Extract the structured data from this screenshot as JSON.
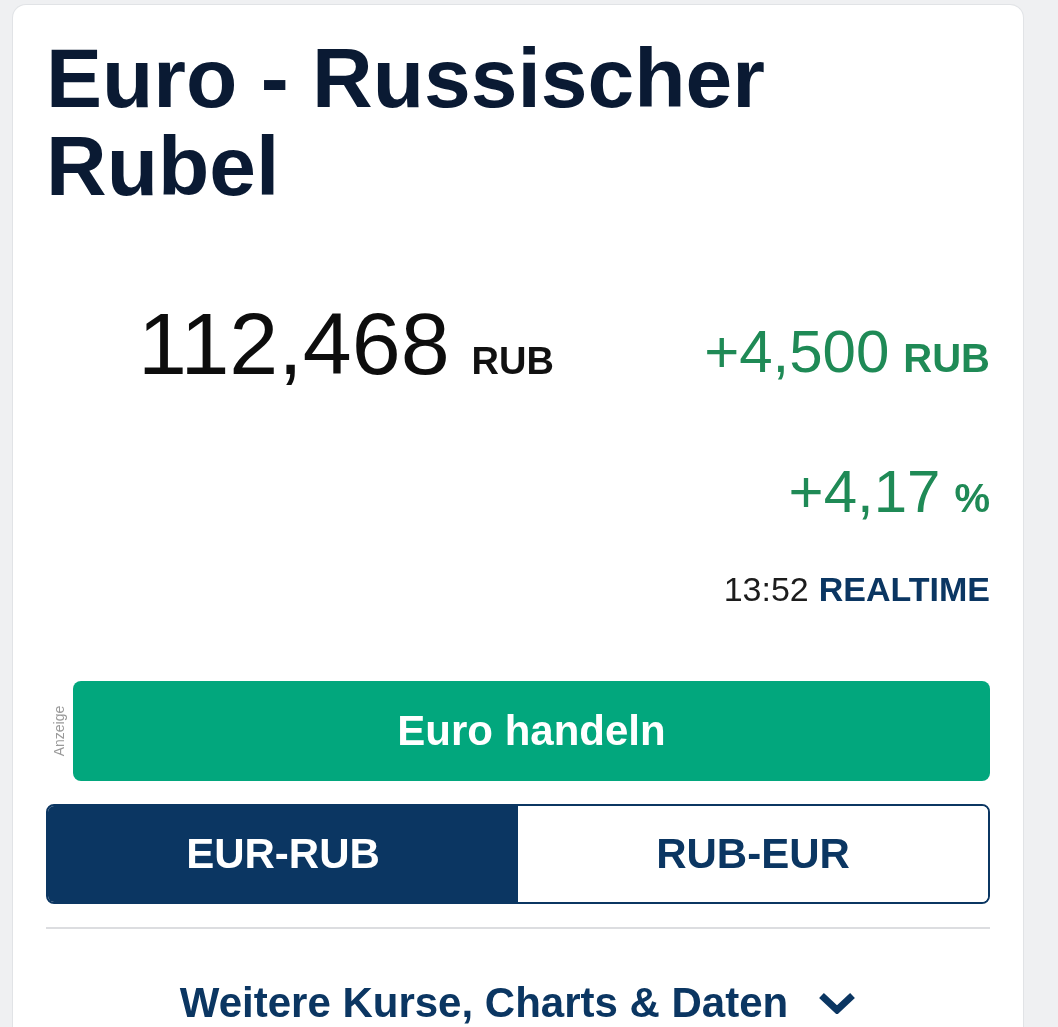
{
  "title": "Euro - Russischer Rubel",
  "quote": {
    "price": "112,468",
    "price_unit": "RUB",
    "change": "+4,500",
    "change_unit": "RUB",
    "change_percent": "+4,17",
    "percent_unit": "%",
    "time": "13:52",
    "feed": "REALTIME"
  },
  "ad": {
    "label": "Anzeige",
    "button": "Euro handeln"
  },
  "pair_tabs": [
    {
      "label": "EUR-RUB",
      "selected": true
    },
    {
      "label": "RUB-EUR",
      "selected": false
    }
  ],
  "more_link": {
    "label": "Weitere Kurse, Charts & Daten",
    "expanded": false
  }
}
